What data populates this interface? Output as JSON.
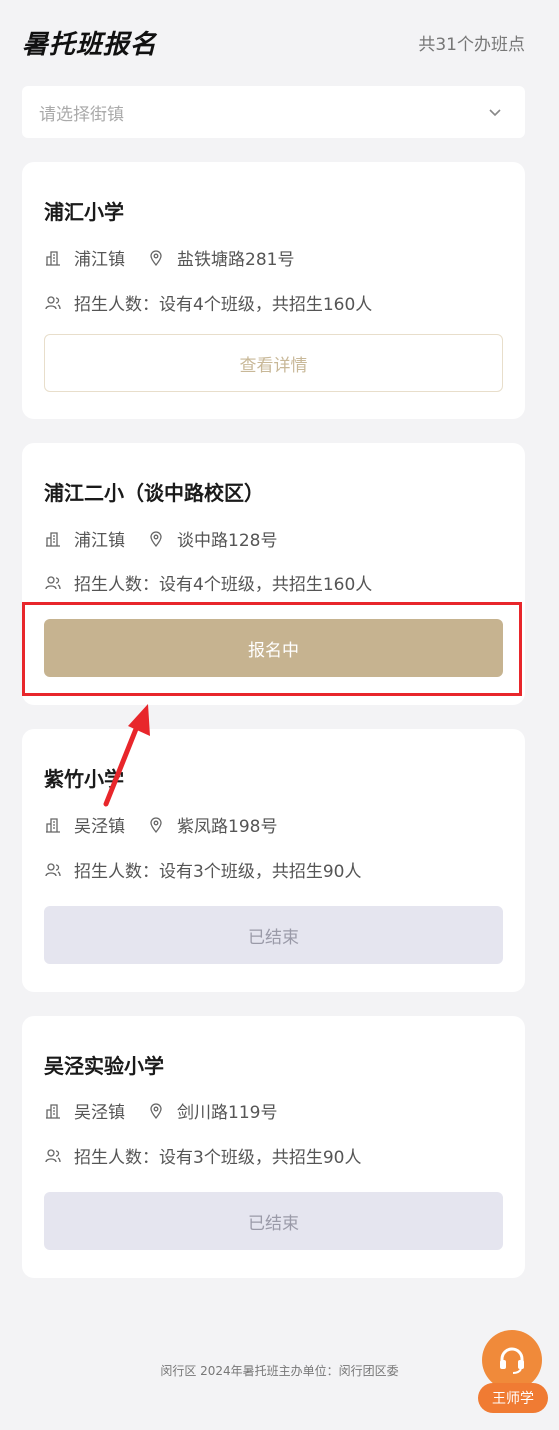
{
  "header": {
    "title": "暑托班报名",
    "site_count": "共31个办班点"
  },
  "filter": {
    "placeholder": "请选择街镇"
  },
  "cards": [
    {
      "name": "浦汇小学",
      "town": "浦江镇",
      "address": "盐铁塘路281号",
      "enrollment": "招生人数：设有4个班级，共招生160人",
      "button": "查看详情",
      "state": "detail"
    },
    {
      "name": "浦江二小（谈中路校区）",
      "town": "浦江镇",
      "address": "谈中路128号",
      "enrollment": "招生人数：设有4个班级，共招生160人",
      "button": "报名中",
      "state": "active"
    },
    {
      "name": "紫竹小学",
      "town": "吴泾镇",
      "address": "紫凤路198号",
      "enrollment": "招生人数：设有3个班级，共招生90人",
      "button": "已结束",
      "state": "ended"
    },
    {
      "name": "吴泾实验小学",
      "town": "吴泾镇",
      "address": "剑川路119号",
      "enrollment": "招生人数：设有3个班级，共招生90人",
      "button": "已结束",
      "state": "ended"
    }
  ],
  "footer": {
    "text": "闵行区 2024年暑托班主办单位：闵行团区委"
  },
  "watermark": {
    "text": "王师学"
  },
  "colors": {
    "accent": "#c6b390",
    "highlight": "#e8262b",
    "fab": "#f08a3a"
  }
}
